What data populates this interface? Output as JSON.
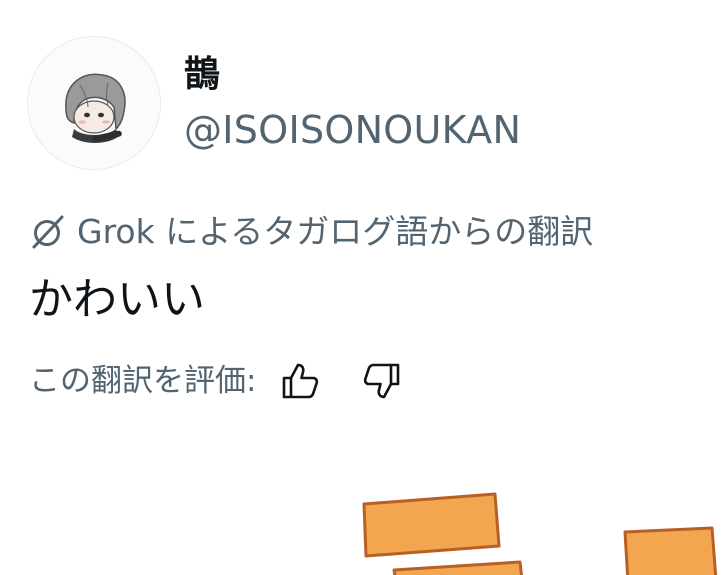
{
  "user": {
    "display_name": "鵲",
    "handle": "@ISOISONOUKAN",
    "avatar_icon": "avatar-image"
  },
  "translation": {
    "source_label": "Grok によるタガログ語からの翻訳",
    "icon": "grok-icon",
    "text": "かわいい"
  },
  "rating": {
    "label": "この翻訳を評価:",
    "thumbs_up_icon": "thumbs-up-icon",
    "thumbs_down_icon": "thumbs-down-icon"
  },
  "colors": {
    "primary_text": "#0f1419",
    "secondary_text": "#536471",
    "media_orange": "#f2a650",
    "media_outline": "#b95f24"
  }
}
